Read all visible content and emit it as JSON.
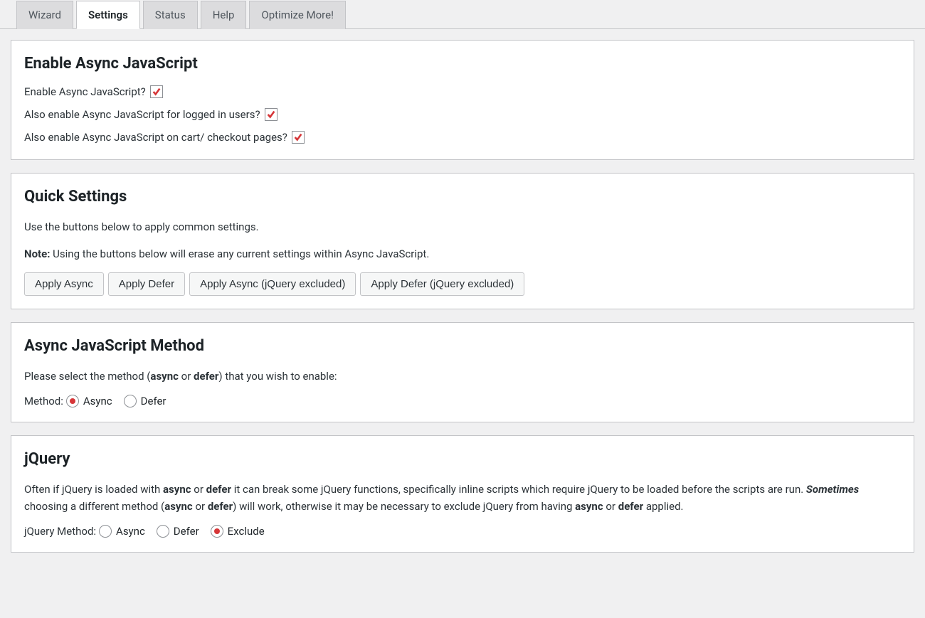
{
  "tabs": {
    "wizard": "Wizard",
    "settings": "Settings",
    "status": "Status",
    "help": "Help",
    "optimize": "Optimize More!"
  },
  "enable_panel": {
    "heading": "Enable Async JavaScript",
    "q1": "Enable Async JavaScript?",
    "q2": "Also enable Async JavaScript for logged in users?",
    "q3": "Also enable Async JavaScript on cart/ checkout pages?",
    "c1": true,
    "c2": true,
    "c3": true
  },
  "quick_panel": {
    "heading": "Quick Settings",
    "p1": "Use the buttons below to apply common settings.",
    "note_label": "Note:",
    "note_text": " Using the buttons below will erase any current settings within Async JavaScript.",
    "btn1": "Apply Async",
    "btn2": "Apply Defer",
    "btn3": "Apply Async (jQuery excluded)",
    "btn4": "Apply Defer (jQuery excluded)"
  },
  "method_panel": {
    "heading": "Async JavaScript Method",
    "p1_a": "Please select the method (",
    "p1_b": "async",
    "p1_c": " or ",
    "p1_d": "defer",
    "p1_e": ") that you wish to enable:",
    "label": "Method:",
    "opt_async": "Async",
    "opt_defer": "Defer",
    "selected": "async"
  },
  "jquery_panel": {
    "heading": "jQuery",
    "t1": "Often if jQuery is loaded with ",
    "t2": "async",
    "t3": " or ",
    "t4": "defer",
    "t5": " it can break some jQuery functions, specifically inline scripts which require jQuery to be loaded before the scripts are run. ",
    "t6": "Sometimes",
    "t7": " choosing a different method (",
    "t8": "async",
    "t9": " or ",
    "t10": "defer",
    "t11": ") will work, otherwise it may be necessary to exclude jQuery from having ",
    "t12": "async",
    "t13": " or ",
    "t14": "defer",
    "t15": " applied.",
    "label": "jQuery Method:",
    "opt_async": "Async",
    "opt_defer": "Defer",
    "opt_exclude": "Exclude",
    "selected": "exclude"
  }
}
